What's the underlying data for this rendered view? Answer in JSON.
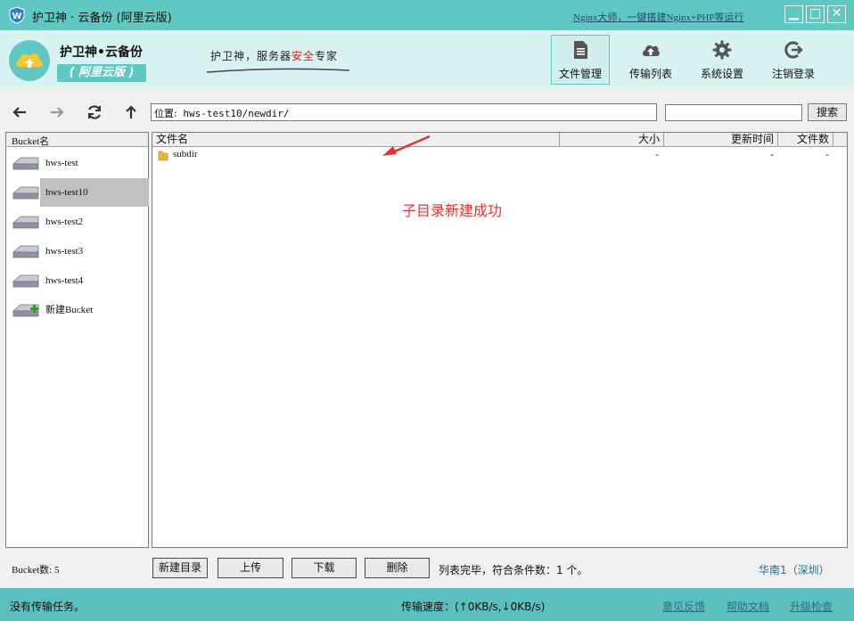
{
  "window": {
    "title": "护卫神 · 云备份 (阿里云版)",
    "promo_link": "Nginx大师，一键搭建Nginx+PHP等运行",
    "min_glyph": "▁",
    "max_glyph": "□",
    "close_glyph": "✕"
  },
  "brand": {
    "name": "护卫神•云备份",
    "edition": "( 阿里云版 )",
    "slogan_pre": "护卫神，服务器",
    "slogan_highlight": "安全",
    "slogan_post": "专家"
  },
  "nav": {
    "items": [
      {
        "label": "文件管理",
        "icon": "document-icon",
        "active": true
      },
      {
        "label": "传输列表",
        "icon": "cloud-upload-icon",
        "active": false
      },
      {
        "label": "系统设置",
        "icon": "gear-icon",
        "active": false
      },
      {
        "label": "注销登录",
        "icon": "logout-icon",
        "active": false
      }
    ]
  },
  "toolbar": {
    "path_label": "位置:",
    "path_value": "hws-test10/newdir/",
    "search_value": "",
    "search_button": "搜索"
  },
  "buckets": {
    "header": "Bucket名",
    "items": [
      {
        "label": "hws-test",
        "selected": false
      },
      {
        "label": "hws-test10",
        "selected": true
      },
      {
        "label": "hws-test2",
        "selected": false
      },
      {
        "label": "hws-test3",
        "selected": false
      },
      {
        "label": "hws-test4",
        "selected": false
      },
      {
        "label": "新建Bucket",
        "selected": false,
        "is_new": true
      }
    ],
    "count_text": "Bucket数: 5"
  },
  "files": {
    "columns": {
      "name": "文件名",
      "size": "大小",
      "updated": "更新时间",
      "count": "文件数"
    },
    "rows": [
      {
        "name": "subdir",
        "size": "-",
        "updated": "-",
        "count": "-",
        "type": "folder"
      }
    ]
  },
  "annotation": {
    "text": "子目录新建成功"
  },
  "actions": {
    "new_dir": "新建目录",
    "upload": "上传",
    "download": "下载",
    "delete": "删除",
    "status": "列表完毕，符合条件数：1 个。",
    "region": "华南1（深圳）"
  },
  "statusbar": {
    "tasks": "没有传输任务。",
    "speed": "传输速度：(↑0KB/s,↓0KB/s)",
    "feedback": "意见反馈",
    "help": "帮助文档",
    "upgrade": "升级检查"
  },
  "colors": {
    "accent": "#5fc8c3",
    "header_bg": "#d8f2f1",
    "annotation": "#e0352f",
    "highlight": "#d0241f"
  }
}
